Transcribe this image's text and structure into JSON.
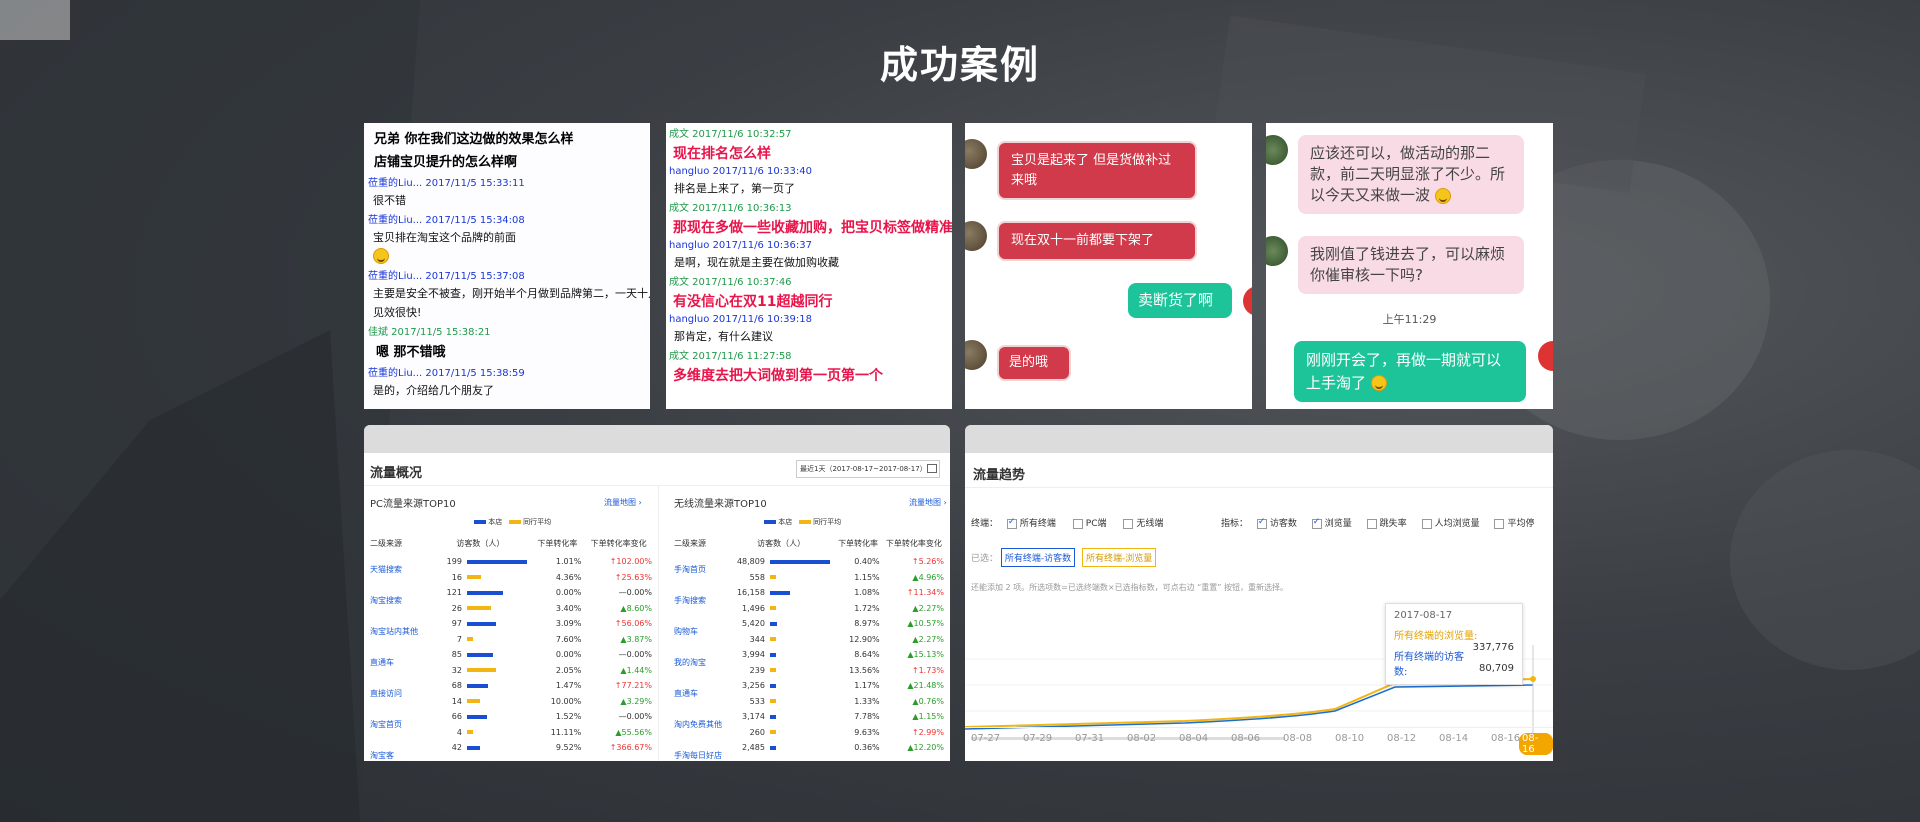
{
  "title": "成功案例",
  "card1": {
    "header": [
      "兄弟  你在我们这边做的效果怎么样",
      "店铺宝贝提升的怎么样啊"
    ],
    "lines": [
      {
        "t": "meta",
        "v": "莅重的Liu... 2017/11/5 15:33:11"
      },
      {
        "t": "msg",
        "v": "很不错"
      },
      {
        "t": "meta",
        "v": "莅重的Liu... 2017/11/5 15:34:08"
      },
      {
        "t": "msg",
        "v": "宝贝排在淘宝这个品牌的前面"
      },
      {
        "t": "emoji",
        "v": ""
      },
      {
        "t": "meta",
        "v": "莅重的Liu... 2017/11/5 15:37:08"
      },
      {
        "t": "msg",
        "v": "主要是安全不被查，刚开始半个月做到品牌第二，一天十几"
      },
      {
        "t": "msg",
        "v": "见效很快!"
      },
      {
        "t": "metag",
        "v": "佳斌 2017/11/5 15:38:21"
      },
      {
        "t": "big",
        "v": "嗯  那不错哦"
      },
      {
        "t": "meta",
        "v": "莅重的Liu... 2017/11/5 15:38:59"
      },
      {
        "t": "msg",
        "v": "是的，介绍给几个朋友了"
      }
    ]
  },
  "card2": {
    "lines": [
      {
        "t": "metag",
        "v": "成文 2017/11/6 10:32:57"
      },
      {
        "t": "red",
        "v": "现在排名怎么样"
      },
      {
        "t": "meta",
        "v": "hangluo 2017/11/6 10:33:40"
      },
      {
        "t": "msg",
        "v": "排名是上来了，第一页了"
      },
      {
        "t": "metag",
        "v": "成文 2017/11/6 10:36:13"
      },
      {
        "t": "red",
        "v": "那现在多做一些收藏加购，把宝贝标签做精准"
      },
      {
        "t": "meta",
        "v": "hangluo 2017/11/6 10:36:37"
      },
      {
        "t": "msg",
        "v": "是啊，现在就是主要在做加购收藏"
      },
      {
        "t": "metag",
        "v": "成文 2017/11/6 10:37:46"
      },
      {
        "t": "red",
        "v": "有没信心在双11超越同行"
      },
      {
        "t": "meta",
        "v": "hangluo 2017/11/6 10:39:18"
      },
      {
        "t": "msg",
        "v": "那肯定，有什么建议"
      },
      {
        "t": "metag",
        "v": "成文 2017/11/6 11:27:58"
      },
      {
        "t": "red",
        "v": "多维度去把大词做到第一页第一个"
      }
    ]
  },
  "card3": {
    "b1": [
      "宝贝是起来了  但是货做补过",
      "来哦"
    ],
    "b2": "现在双十一前都要下架了",
    "b3": "卖断货了啊",
    "b4": "是的哦"
  },
  "card4": {
    "b1": [
      "应该还可以，做活动的那二",
      "款，前二天明显涨了不少。所",
      "以今天又来做一波"
    ],
    "b2": [
      "我刚值了钱进去了，可以麻烦",
      "你催审核一下吗?"
    ],
    "time": "上午11:29",
    "b3": [
      "刚刚开会了，再做一期就可以",
      "上手淘了"
    ]
  },
  "traffic": {
    "title": "流量概况",
    "date": "最近1天（2017-08-17~2017-08-17）",
    "pc_title": "PC流量来源TOP10",
    "wl_title": "无线流量来源TOP10",
    "map_link": "流量地图 ›",
    "legend_store": "本店",
    "legend_avg": "同行平均",
    "cols": [
      "二级来源",
      "访客数（人）",
      "下单转化率",
      "下单转化率变化"
    ],
    "pc_rows": [
      {
        "name": "天猫搜索",
        "a": "199",
        "ar": "1.01%",
        "ac": "↑102.00%",
        "b": "16",
        "br": "4.36%",
        "bc": "↑25.63%"
      },
      {
        "name": "淘宝搜索",
        "a": "121",
        "ar": "0.00%",
        "ac": "—0.00%",
        "b": "26",
        "br": "3.40%",
        "bc": "▲8.60%"
      },
      {
        "name": "淘宝站内其他",
        "a": "97",
        "ar": "3.09%",
        "ac": "↑56.06%",
        "b": "7",
        "br": "7.60%",
        "bc": "▲3.87%"
      },
      {
        "name": "直通车",
        "a": "85",
        "ar": "0.00%",
        "ac": "—0.00%",
        "b": "32",
        "br": "2.05%",
        "bc": "▲1.44%"
      },
      {
        "name": "直接访问",
        "a": "68",
        "ar": "1.47%",
        "ac": "↑77.21%",
        "b": "14",
        "br": "10.00%",
        "bc": "▲3.29%"
      },
      {
        "name": "淘宝首页",
        "a": "66",
        "ar": "1.52%",
        "ac": "—0.00%",
        "b": "4",
        "br": "11.11%",
        "bc": "▲55.56%"
      },
      {
        "name": "淘宝客",
        "a": "42",
        "ar": "9.52%",
        "ac": "↑366.67%",
        "b": "",
        "br": "",
        "bc": ""
      }
    ],
    "wl_rows": [
      {
        "name": "手淘首页",
        "a": "48,809",
        "ar": "0.40%",
        "ac": "↑5.26%",
        "b": "558",
        "br": "1.15%",
        "bc": "▲4.96%"
      },
      {
        "name": "手淘搜索",
        "a": "16,158",
        "ar": "1.08%",
        "ac": "↑11.34%",
        "b": "1,496",
        "br": "1.72%",
        "bc": "▲2.27%"
      },
      {
        "name": "购物车",
        "a": "5,420",
        "ar": "8.97%",
        "ac": "▲10.57%",
        "b": "344",
        "br": "12.90%",
        "bc": "▲2.27%"
      },
      {
        "name": "我的淘宝",
        "a": "3,994",
        "ar": "8.64%",
        "ac": "▲15.13%",
        "b": "239",
        "br": "13.56%",
        "bc": "↑1.73%"
      },
      {
        "name": "直通车",
        "a": "3,256",
        "ar": "1.17%",
        "ac": "▲21.48%",
        "b": "533",
        "br": "1.33%",
        "bc": "▲0.76%"
      },
      {
        "name": "淘内免费其他",
        "a": "3,174",
        "ar": "7.78%",
        "ac": "▲1.15%",
        "b": "260",
        "br": "9.63%",
        "bc": "↑2.99%"
      },
      {
        "name": "手淘每日好店",
        "a": "2,485",
        "ar": "0.36%",
        "ac": "▲12.20%",
        "b": "",
        "br": "",
        "bc": ""
      }
    ]
  },
  "trend": {
    "title": "流量趋势",
    "terminal_label": "终端：",
    "terminals": [
      {
        "label": "所有终端",
        "on": true
      },
      {
        "label": "PC端",
        "on": false
      },
      {
        "label": "无线端",
        "on": false
      }
    ],
    "metric_label": "指标：",
    "metrics": [
      {
        "label": "访客数",
        "on": true
      },
      {
        "label": "浏览量",
        "on": true
      },
      {
        "label": "跳失率",
        "on": false
      },
      {
        "label": "人均浏览量",
        "on": false
      },
      {
        "label": "平均停",
        "on": false
      }
    ],
    "selected_label": "已选：",
    "sel1": "所有终端-访客数",
    "sel2": "所有终端-浏览量",
    "hint": "还能添加 2 项。所选项数=已选终端数×已选指标数，可点右边 “重置” 按钮，重新选择。",
    "tip_date": "2017-08-17",
    "tip_l1": "所有终端的浏览量:",
    "tip_v1": "337,776",
    "tip_l2": "所有终端的访客数:",
    "tip_v2": "80,709",
    "xticks": [
      "07-27",
      "07-29",
      "07-31",
      "08-02",
      "08-04",
      "08-06",
      "08-08",
      "08-10",
      "08-12",
      "08-14",
      "08-16",
      "08-16"
    ]
  }
}
